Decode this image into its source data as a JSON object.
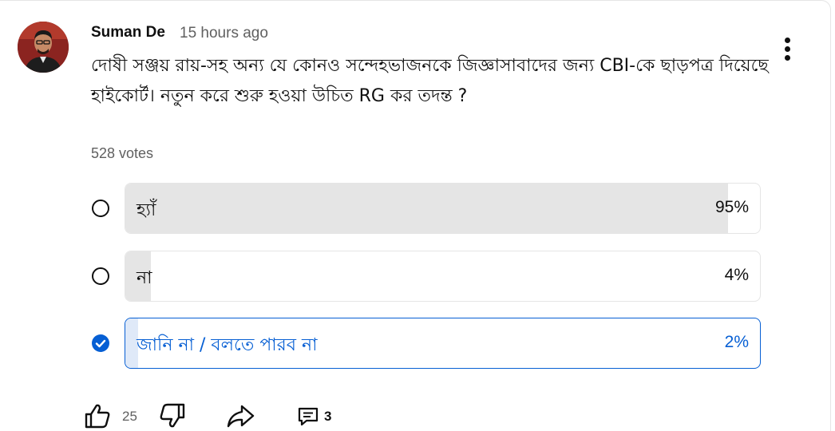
{
  "post": {
    "author": "Suman De",
    "time": "15 hours ago",
    "question": "দোষী সঞ্জয় রায়-সহ অন্য যে কোনও সন্দেহভাজনকে জিজ্ঞাসাবাদের জন্য CBI-কে ছাড়পত্র দিয়েছে হাইকোর্ট। নতুন করে শুরু হওয়া উচিত RG কর তদন্ত ?",
    "votes": "528 votes"
  },
  "poll": {
    "options": [
      {
        "label": "হ্যাঁ",
        "percent_text": "95%",
        "fill_fraction": 0.95,
        "selected": false
      },
      {
        "label": "না",
        "percent_text": "4%",
        "fill_fraction": 0.04,
        "selected": false
      },
      {
        "label": "জানি না / বলতে পারব না",
        "percent_text": "2%",
        "fill_fraction": 0.02,
        "selected": true
      }
    ]
  },
  "actions": {
    "like_count": "25",
    "comment_count": "3",
    "icons": [
      "thumbs-up-icon",
      "thumbs-down-icon",
      "share-icon",
      "comment-icon",
      "more-vertical-icon"
    ]
  },
  "colors": {
    "accent": "#065fd4",
    "bar_fill": "#e5e5e5",
    "selected_fill": "#dfe9f8",
    "muted_text": "#606060"
  }
}
